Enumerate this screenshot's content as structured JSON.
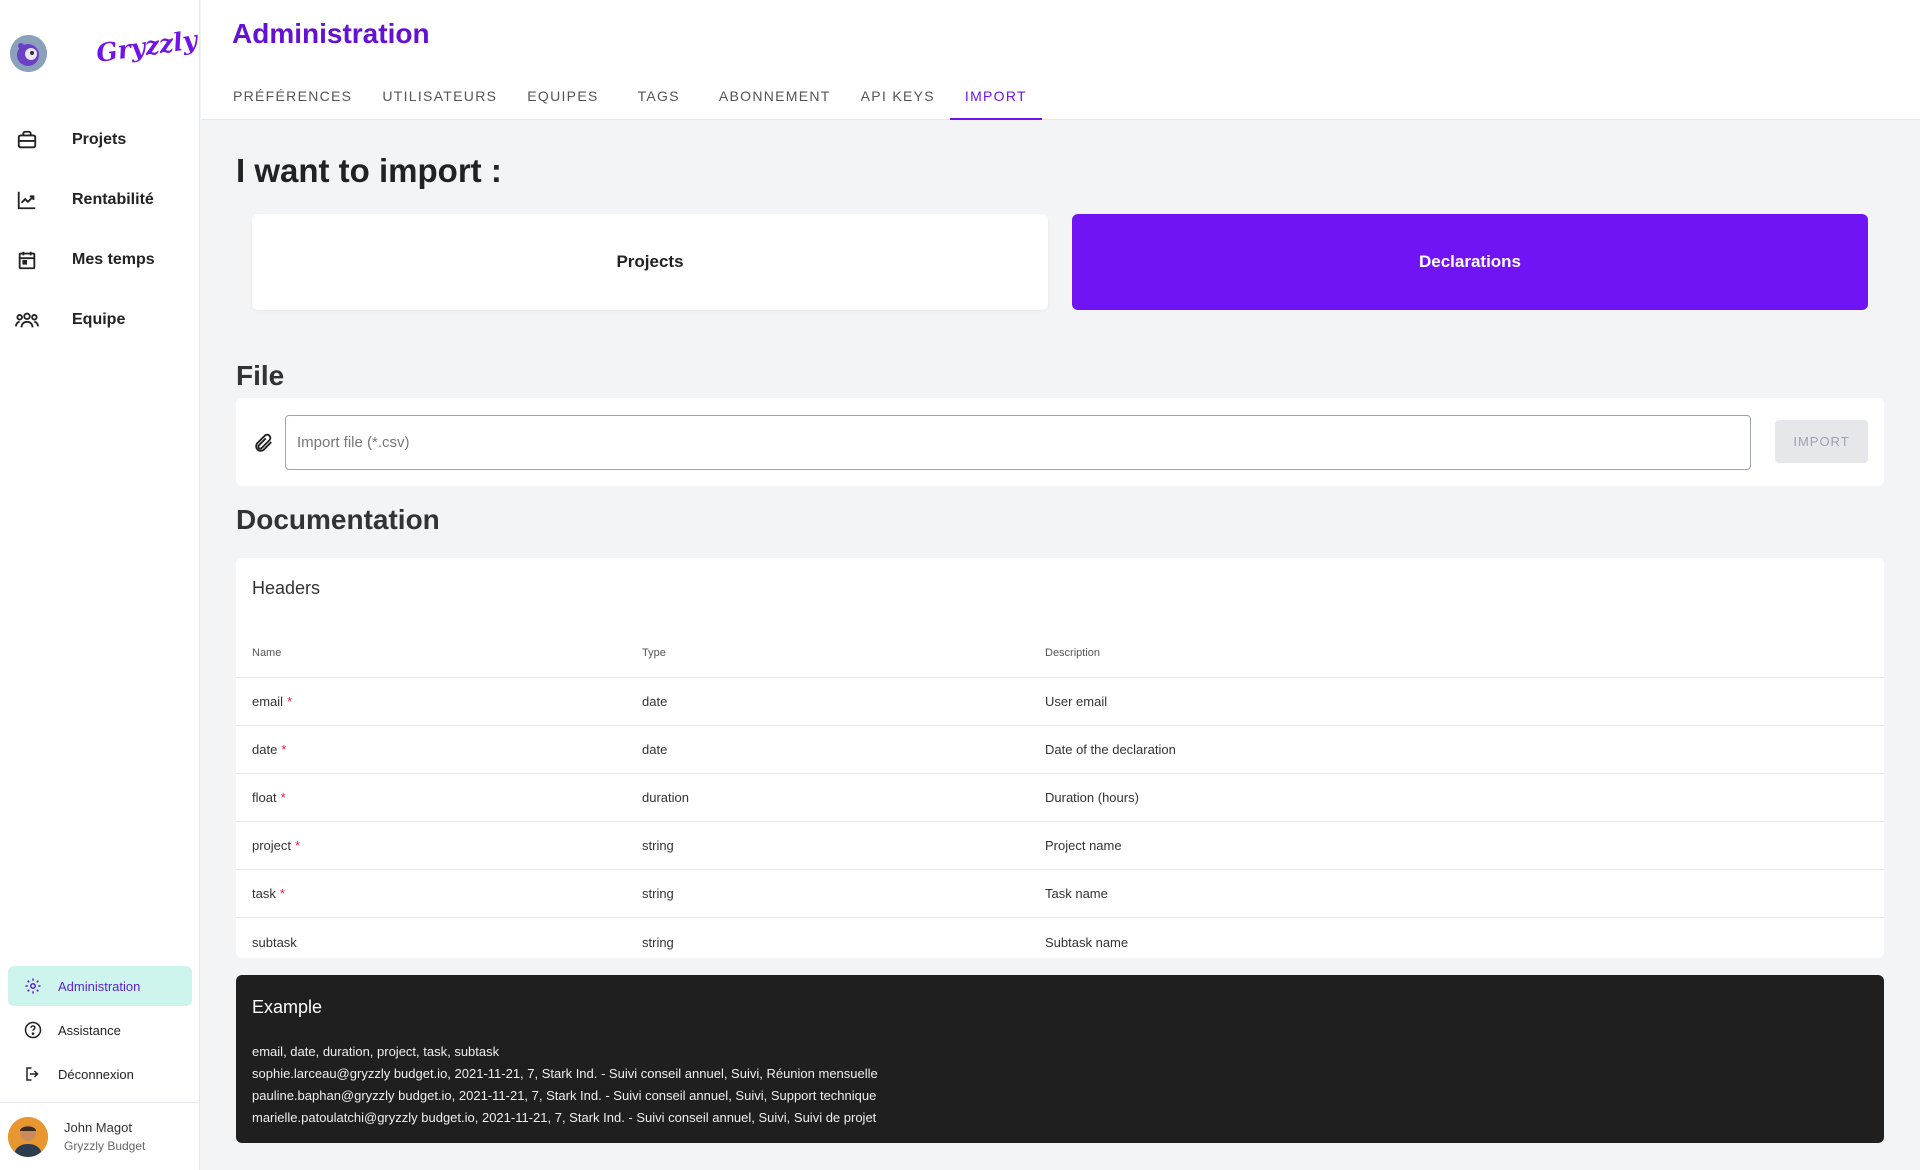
{
  "sidebar": {
    "logo": "Gryzzly",
    "nav": [
      {
        "label": "Projets",
        "icon": "briefcase-icon"
      },
      {
        "label": "Rentabilité",
        "icon": "trending-up-icon"
      },
      {
        "label": "Mes temps",
        "icon": "calendar-icon"
      },
      {
        "label": "Equipe",
        "icon": "users-icon"
      }
    ],
    "bottom": [
      {
        "label": "Administration",
        "icon": "gear-icon",
        "active": true
      },
      {
        "label": "Assistance",
        "icon": "help-circle-icon",
        "active": false
      },
      {
        "label": "Déconnexion",
        "icon": "logout-icon",
        "active": false
      }
    ],
    "user": {
      "name": "John Magot",
      "org": "Gryzzly Budget"
    }
  },
  "header": {
    "title": "Administration",
    "tabs": [
      {
        "label": "PRÉFÉRENCES"
      },
      {
        "label": "UTILISATEURS"
      },
      {
        "label": "EQUIPES"
      },
      {
        "label": "TAGS"
      },
      {
        "label": "ABONNEMENT"
      },
      {
        "label": "API KEYS"
      },
      {
        "label": "IMPORT",
        "active": true
      }
    ]
  },
  "main": {
    "import_heading": "I want to import :",
    "choices": {
      "projects": "Projects",
      "declarations": "Declarations",
      "selected": "Declarations"
    },
    "file_heading": "File",
    "file_placeholder": "Import file (*.csv)",
    "import_button": "IMPORT",
    "doc_heading": "Documentation",
    "headers_title": "Headers",
    "columns": {
      "name": "Name",
      "type": "Type",
      "description": "Description"
    },
    "rows": [
      {
        "name": "email",
        "required": "*",
        "type": "date",
        "description": "User email"
      },
      {
        "name": "date",
        "required": "*",
        "type": "date",
        "description": "Date of the declaration"
      },
      {
        "name": "float",
        "required": "*",
        "type": "duration",
        "description": "Duration (hours)"
      },
      {
        "name": "project",
        "required": "*",
        "type": "string",
        "description": "Project name"
      },
      {
        "name": "task",
        "required": "*",
        "type": "string",
        "description": "Task name"
      },
      {
        "name": "subtask",
        "required": "",
        "type": "string",
        "description": "Subtask name"
      }
    ],
    "example": {
      "title": "Example",
      "lines": [
        "email, date, duration, project, task, subtask",
        "sophie.larceau@gryzzly budget.io, 2021-11-21, 7, Stark Ind. - Suivi conseil annuel, Suivi, Réunion mensuelle",
        "pauline.baphan@gryzzly budget.io, 2021-11-21, 7, Stark Ind. - Suivi conseil annuel, Suivi, Support technique",
        "marielle.patoulatchi@gryzzly budget.io, 2021-11-21, 7, Stark Ind. - Suivi conseil annuel, Suivi, Suivi de projet"
      ]
    }
  },
  "colors": {
    "accent": "#7014e8",
    "selected_card": "#7014f6",
    "active_nav_bg": "#cdf5ee",
    "required": "#e11d48"
  }
}
